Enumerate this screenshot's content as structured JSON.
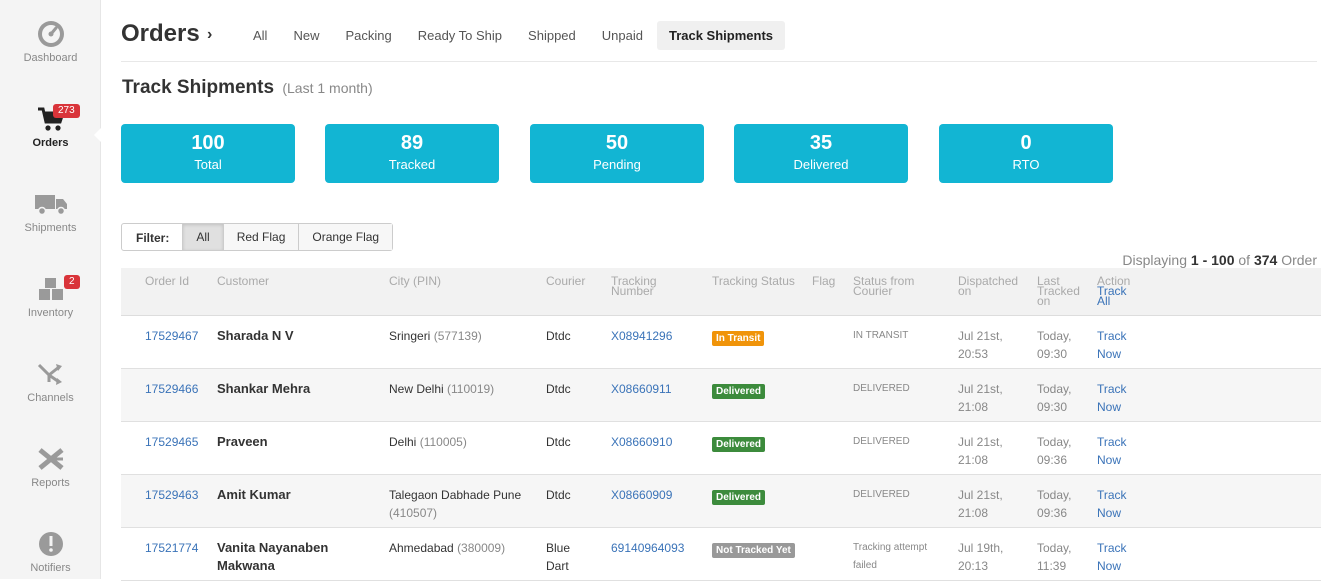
{
  "sidebar": {
    "items": [
      {
        "label": "Dashboard",
        "icon": "dashboard-icon"
      },
      {
        "label": "Orders",
        "icon": "cart-icon",
        "badge": "273"
      },
      {
        "label": "Shipments",
        "icon": "truck-icon"
      },
      {
        "label": "Inventory",
        "icon": "boxes-icon",
        "badge": "2"
      },
      {
        "label": "Channels",
        "icon": "shuffle-icon"
      },
      {
        "label": "Reports",
        "icon": "reports-icon"
      },
      {
        "label": "Notifiers",
        "icon": "alert-icon"
      }
    ]
  },
  "header": {
    "title": "Orders",
    "chevron": "›",
    "tabs": [
      "All",
      "New",
      "Packing",
      "Ready To Ship",
      "Shipped",
      "Unpaid",
      "Track Shipments"
    ]
  },
  "section": {
    "title": "Track Shipments",
    "subtitle": "(Last 1 month)"
  },
  "stats": [
    {
      "value": "100",
      "label": "Total"
    },
    {
      "value": "89",
      "label": "Tracked"
    },
    {
      "value": "50",
      "label": "Pending"
    },
    {
      "value": "35",
      "label": "Delivered"
    },
    {
      "value": "0",
      "label": "RTO"
    }
  ],
  "filter": {
    "label": "Filter:",
    "options": [
      "All",
      "Red Flag",
      "Orange Flag"
    ]
  },
  "displaying": {
    "prefix": "Displaying",
    "range": "1 - 100",
    "of": "of",
    "total": "374",
    "suffix": "Order"
  },
  "table": {
    "headers": {
      "order_id": "Order Id",
      "customer": "Customer",
      "city": "City (PIN)",
      "courier": "Courier",
      "tracking_number": "Tracking Number",
      "tracking_status": "Tracking Status",
      "flag": "Flag",
      "status_from_courier": "Status from Courier",
      "dispatched_on": "Dispatched on",
      "last_tracked_on": "Last Tracked on",
      "action": "Action",
      "track_all": "Track All"
    },
    "rows": [
      {
        "order_id": "17529467",
        "customer": "Sharada N V",
        "city": "Sringeri",
        "pin": "(577139)",
        "courier": "Dtdc",
        "tracking_number": "X08941296",
        "status": "In Transit",
        "status_color": "#f0940a",
        "courier_status": "IN TRANSIT",
        "dispatched": "Jul 21st, 20:53",
        "last_tracked": "Today, 09:30",
        "action": "Track Now"
      },
      {
        "order_id": "17529466",
        "customer": "Shankar Mehra",
        "city": "New Delhi",
        "pin": "(110019)",
        "courier": "Dtdc",
        "tracking_number": "X08660911",
        "status": "Delivered",
        "status_color": "#3c8b3c",
        "courier_status": "DELIVERED",
        "dispatched": "Jul 21st, 21:08",
        "last_tracked": "Today, 09:30",
        "action": "Track Now"
      },
      {
        "order_id": "17529465",
        "customer": "Praveen",
        "city": "Delhi",
        "pin": "(110005)",
        "courier": "Dtdc",
        "tracking_number": "X08660910",
        "status": "Delivered",
        "status_color": "#3c8b3c",
        "courier_status": "DELIVERED",
        "dispatched": "Jul 21st, 21:08",
        "last_tracked": "Today, 09:36",
        "action": "Track Now"
      },
      {
        "order_id": "17529463",
        "customer": "Amit Kumar",
        "city": "Talegaon Dabhade Pune",
        "pin": "(410507)",
        "courier": "Dtdc",
        "tracking_number": "X08660909",
        "status": "Delivered",
        "status_color": "#3c8b3c",
        "courier_status": "DELIVERED",
        "dispatched": "Jul 21st, 21:08",
        "last_tracked": "Today, 09:36",
        "action": "Track Now"
      },
      {
        "order_id": "17521774",
        "customer": "Vanita Nayanaben Makwana",
        "city": "Ahmedabad",
        "pin": "(380009)",
        "courier": "Blue Dart",
        "tracking_number": "69140964093",
        "status": "Not Tracked Yet",
        "status_color": "#999999",
        "courier_status": "Tracking attempt failed",
        "dispatched": "Jul 19th, 20:13",
        "last_tracked": "Today, 11:39",
        "action": "Track Now"
      }
    ]
  },
  "colors": {
    "accent": "#12b5d3",
    "link": "#3a73b8",
    "badge_red": "#d9343a"
  }
}
